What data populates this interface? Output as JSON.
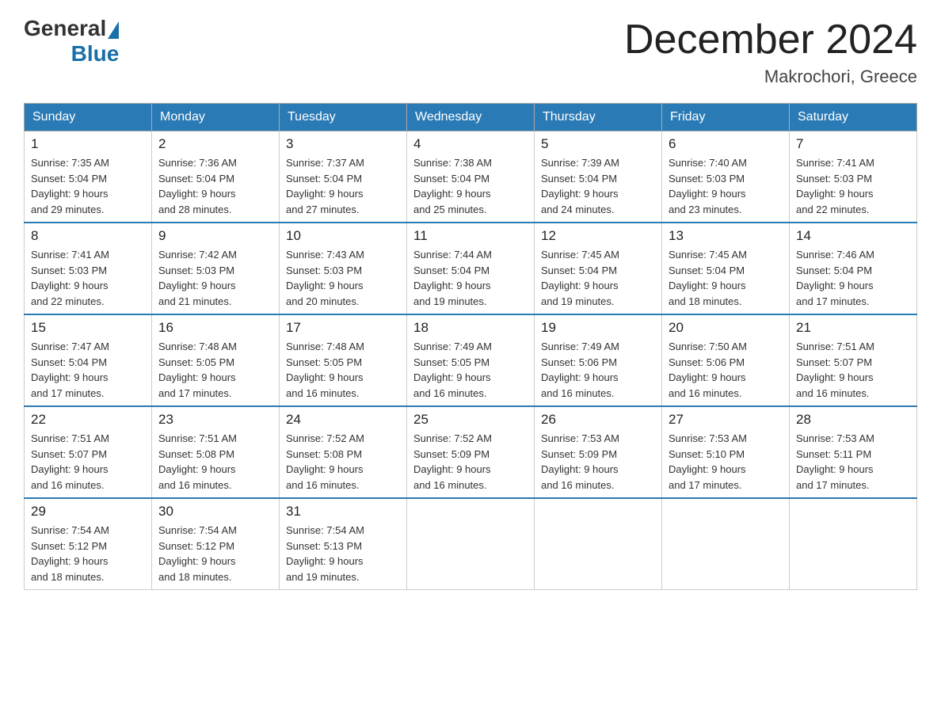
{
  "header": {
    "logo_general": "General",
    "logo_blue": "Blue",
    "month_title": "December 2024",
    "location": "Makrochori, Greece"
  },
  "days_of_week": [
    "Sunday",
    "Monday",
    "Tuesday",
    "Wednesday",
    "Thursday",
    "Friday",
    "Saturday"
  ],
  "weeks": [
    [
      {
        "day": "1",
        "sunrise": "7:35 AM",
        "sunset": "5:04 PM",
        "daylight_hours": "9",
        "daylight_minutes": "29"
      },
      {
        "day": "2",
        "sunrise": "7:36 AM",
        "sunset": "5:04 PM",
        "daylight_hours": "9",
        "daylight_minutes": "28"
      },
      {
        "day": "3",
        "sunrise": "7:37 AM",
        "sunset": "5:04 PM",
        "daylight_hours": "9",
        "daylight_minutes": "27"
      },
      {
        "day": "4",
        "sunrise": "7:38 AM",
        "sunset": "5:04 PM",
        "daylight_hours": "9",
        "daylight_minutes": "25"
      },
      {
        "day": "5",
        "sunrise": "7:39 AM",
        "sunset": "5:04 PM",
        "daylight_hours": "9",
        "daylight_minutes": "24"
      },
      {
        "day": "6",
        "sunrise": "7:40 AM",
        "sunset": "5:03 PM",
        "daylight_hours": "9",
        "daylight_minutes": "23"
      },
      {
        "day": "7",
        "sunrise": "7:41 AM",
        "sunset": "5:03 PM",
        "daylight_hours": "9",
        "daylight_minutes": "22"
      }
    ],
    [
      {
        "day": "8",
        "sunrise": "7:41 AM",
        "sunset": "5:03 PM",
        "daylight_hours": "9",
        "daylight_minutes": "22"
      },
      {
        "day": "9",
        "sunrise": "7:42 AM",
        "sunset": "5:03 PM",
        "daylight_hours": "9",
        "daylight_minutes": "21"
      },
      {
        "day": "10",
        "sunrise": "7:43 AM",
        "sunset": "5:03 PM",
        "daylight_hours": "9",
        "daylight_minutes": "20"
      },
      {
        "day": "11",
        "sunrise": "7:44 AM",
        "sunset": "5:04 PM",
        "daylight_hours": "9",
        "daylight_minutes": "19"
      },
      {
        "day": "12",
        "sunrise": "7:45 AM",
        "sunset": "5:04 PM",
        "daylight_hours": "9",
        "daylight_minutes": "19"
      },
      {
        "day": "13",
        "sunrise": "7:45 AM",
        "sunset": "5:04 PM",
        "daylight_hours": "9",
        "daylight_minutes": "18"
      },
      {
        "day": "14",
        "sunrise": "7:46 AM",
        "sunset": "5:04 PM",
        "daylight_hours": "9",
        "daylight_minutes": "17"
      }
    ],
    [
      {
        "day": "15",
        "sunrise": "7:47 AM",
        "sunset": "5:04 PM",
        "daylight_hours": "9",
        "daylight_minutes": "17"
      },
      {
        "day": "16",
        "sunrise": "7:48 AM",
        "sunset": "5:05 PM",
        "daylight_hours": "9",
        "daylight_minutes": "17"
      },
      {
        "day": "17",
        "sunrise": "7:48 AM",
        "sunset": "5:05 PM",
        "daylight_hours": "9",
        "daylight_minutes": "16"
      },
      {
        "day": "18",
        "sunrise": "7:49 AM",
        "sunset": "5:05 PM",
        "daylight_hours": "9",
        "daylight_minutes": "16"
      },
      {
        "day": "19",
        "sunrise": "7:49 AM",
        "sunset": "5:06 PM",
        "daylight_hours": "9",
        "daylight_minutes": "16"
      },
      {
        "day": "20",
        "sunrise": "7:50 AM",
        "sunset": "5:06 PM",
        "daylight_hours": "9",
        "daylight_minutes": "16"
      },
      {
        "day": "21",
        "sunrise": "7:51 AM",
        "sunset": "5:07 PM",
        "daylight_hours": "9",
        "daylight_minutes": "16"
      }
    ],
    [
      {
        "day": "22",
        "sunrise": "7:51 AM",
        "sunset": "5:07 PM",
        "daylight_hours": "9",
        "daylight_minutes": "16"
      },
      {
        "day": "23",
        "sunrise": "7:51 AM",
        "sunset": "5:08 PM",
        "daylight_hours": "9",
        "daylight_minutes": "16"
      },
      {
        "day": "24",
        "sunrise": "7:52 AM",
        "sunset": "5:08 PM",
        "daylight_hours": "9",
        "daylight_minutes": "16"
      },
      {
        "day": "25",
        "sunrise": "7:52 AM",
        "sunset": "5:09 PM",
        "daylight_hours": "9",
        "daylight_minutes": "16"
      },
      {
        "day": "26",
        "sunrise": "7:53 AM",
        "sunset": "5:09 PM",
        "daylight_hours": "9",
        "daylight_minutes": "16"
      },
      {
        "day": "27",
        "sunrise": "7:53 AM",
        "sunset": "5:10 PM",
        "daylight_hours": "9",
        "daylight_minutes": "17"
      },
      {
        "day": "28",
        "sunrise": "7:53 AM",
        "sunset": "5:11 PM",
        "daylight_hours": "9",
        "daylight_minutes": "17"
      }
    ],
    [
      {
        "day": "29",
        "sunrise": "7:54 AM",
        "sunset": "5:12 PM",
        "daylight_hours": "9",
        "daylight_minutes": "18"
      },
      {
        "day": "30",
        "sunrise": "7:54 AM",
        "sunset": "5:12 PM",
        "daylight_hours": "9",
        "daylight_minutes": "18"
      },
      {
        "day": "31",
        "sunrise": "7:54 AM",
        "sunset": "5:13 PM",
        "daylight_hours": "9",
        "daylight_minutes": "19"
      },
      null,
      null,
      null,
      null
    ]
  ]
}
